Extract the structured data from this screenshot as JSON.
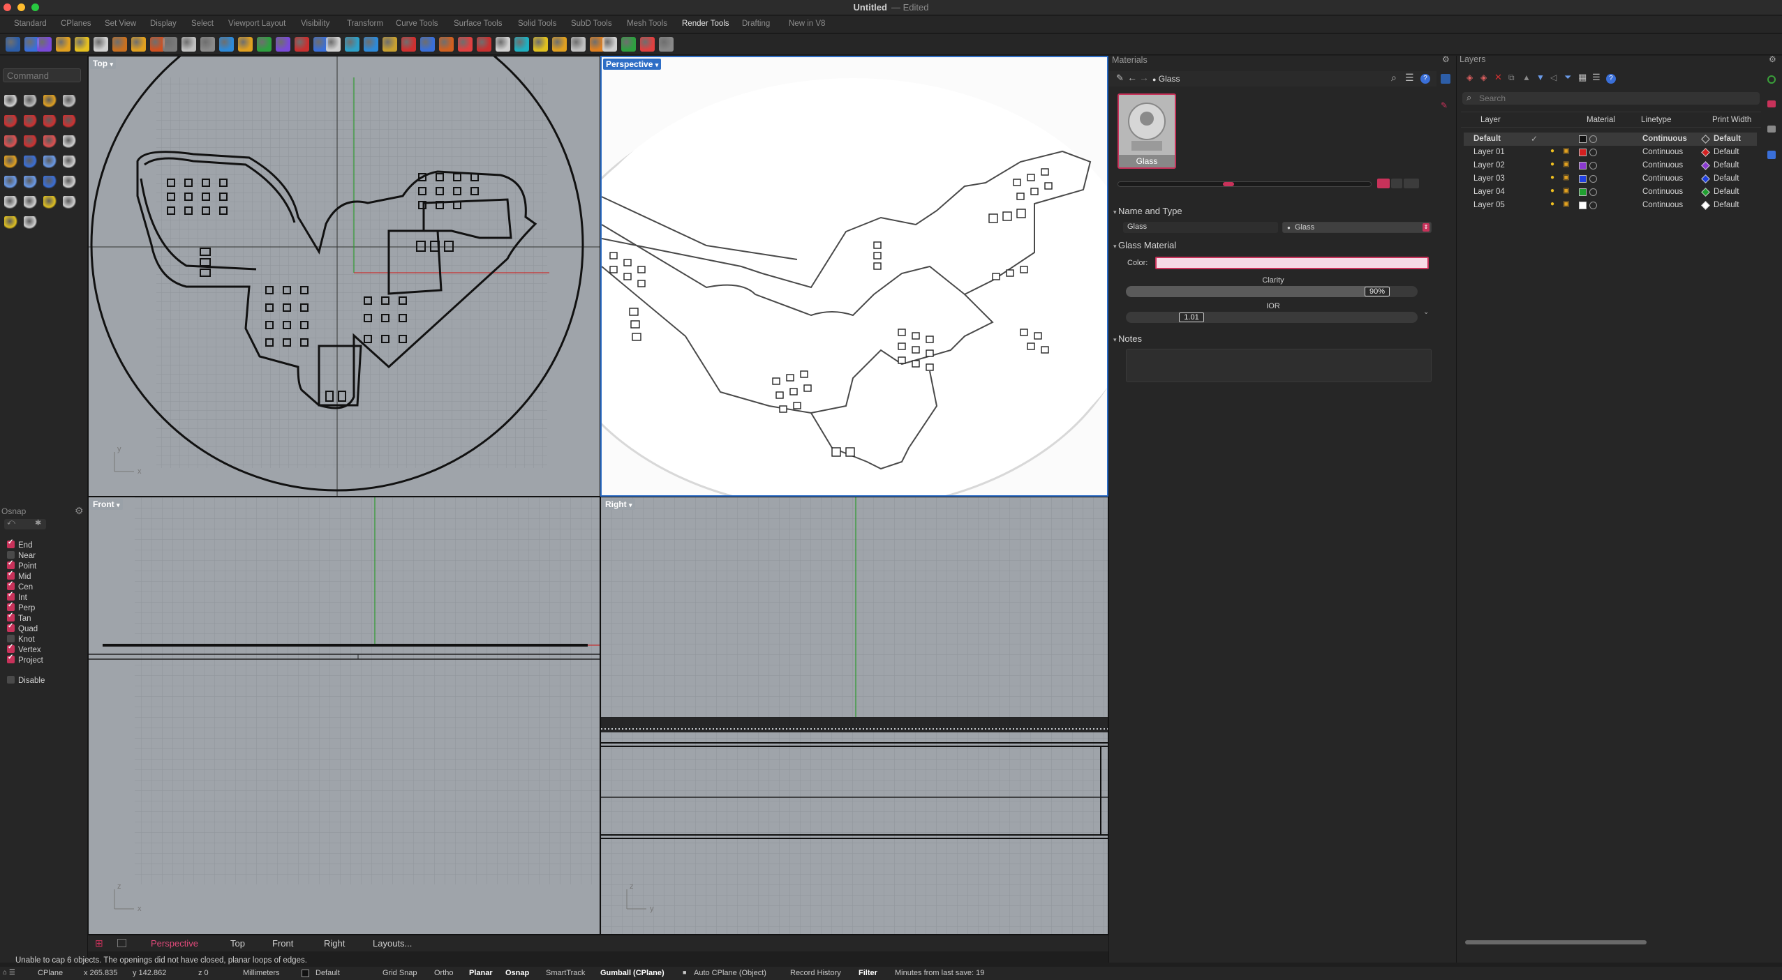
{
  "window": {
    "title": "Untitled",
    "state": "Edited"
  },
  "tabs": [
    "Standard",
    "CPlanes",
    "Set View",
    "Display",
    "Select",
    "Viewport Layout",
    "Visibility",
    "Transform",
    "Curve Tools",
    "Surface Tools",
    "Solid Tools",
    "SubD Tools",
    "Mesh Tools",
    "Render Tools",
    "Drafting",
    "New in V8"
  ],
  "active_tab": "Render Tools",
  "command": {
    "placeholder": "Command"
  },
  "osnap": {
    "title": "Osnap",
    "items": [
      {
        "label": "End",
        "checked": true
      },
      {
        "label": "Near",
        "checked": false
      },
      {
        "label": "Point",
        "checked": true
      },
      {
        "label": "Mid",
        "checked": true
      },
      {
        "label": "Cen",
        "checked": true
      },
      {
        "label": "Int",
        "checked": true
      },
      {
        "label": "Perp",
        "checked": true
      },
      {
        "label": "Tan",
        "checked": true
      },
      {
        "label": "Quad",
        "checked": true
      },
      {
        "label": "Knot",
        "checked": false
      },
      {
        "label": "Vertex",
        "checked": true
      },
      {
        "label": "Project",
        "checked": true
      }
    ],
    "disable_label": "Disable"
  },
  "viewports": {
    "top": {
      "label": "Top",
      "axis_x": "x",
      "axis_y": "y"
    },
    "perspective": {
      "label": "Perspective"
    },
    "front": {
      "label": "Front",
      "axis_x": "x",
      "axis_y": "z"
    },
    "right": {
      "label": "Right",
      "axis_x": "y",
      "axis_y": "z"
    }
  },
  "materials": {
    "title": "Materials",
    "current": "Glass",
    "thumb_label": "Glass",
    "section_name_type": "Name and Type",
    "name_value": "Glass",
    "type_value": "Glass",
    "section_glass": "Glass Material",
    "color_label": "Color:",
    "color_value": "#f6dbe6",
    "clarity_label": "Clarity",
    "clarity_value": "90%",
    "clarity_fraction": 0.9,
    "ior_label": "IOR",
    "ior_value": "1.01",
    "section_notes": "Notes"
  },
  "layers": {
    "title": "Layers",
    "search_placeholder": "Search",
    "headers": {
      "layer": "Layer",
      "material": "Material",
      "linetype": "Linetype",
      "print_width": "Print Width"
    },
    "rows": [
      {
        "name": "Default",
        "color": "#111111",
        "linetype": "Continuous",
        "print_width": "Default",
        "current": true
      },
      {
        "name": "Layer 01",
        "color": "#d42020",
        "linetype": "Continuous",
        "print_width": "Default",
        "current": false
      },
      {
        "name": "Layer 02",
        "color": "#8a3ad0",
        "linetype": "Continuous",
        "print_width": "Default",
        "current": false
      },
      {
        "name": "Layer 03",
        "color": "#2040e0",
        "linetype": "Continuous",
        "print_width": "Default",
        "current": false
      },
      {
        "name": "Layer 04",
        "color": "#20a030",
        "linetype": "Continuous",
        "print_width": "Default",
        "current": false
      },
      {
        "name": "Layer 05",
        "color": "#ffffff",
        "linetype": "Continuous",
        "print_width": "Default",
        "current": false
      }
    ]
  },
  "viewport_tabs": [
    "Perspective",
    "Top",
    "Front",
    "Right",
    "Layouts..."
  ],
  "active_viewport_tab": "Perspective",
  "message": "Unable to cap 6 objects. The openings did not have closed, planar loops of edges.",
  "status": {
    "cplane": "CPlane",
    "x": "x 265.835",
    "y": "y 142.862",
    "z": "z 0",
    "units": "Millimeters",
    "layer": "Default",
    "grid_snap": "Grid Snap",
    "ortho": "Ortho",
    "planar": "Planar",
    "osnap": "Osnap",
    "smarttrack": "SmartTrack",
    "gumball": "Gumball (CPlane)",
    "auto_cplane": "Auto CPlane (Object)",
    "record_history": "Record History",
    "filter": "Filter",
    "save_info": "Minutes from last save: 19"
  }
}
